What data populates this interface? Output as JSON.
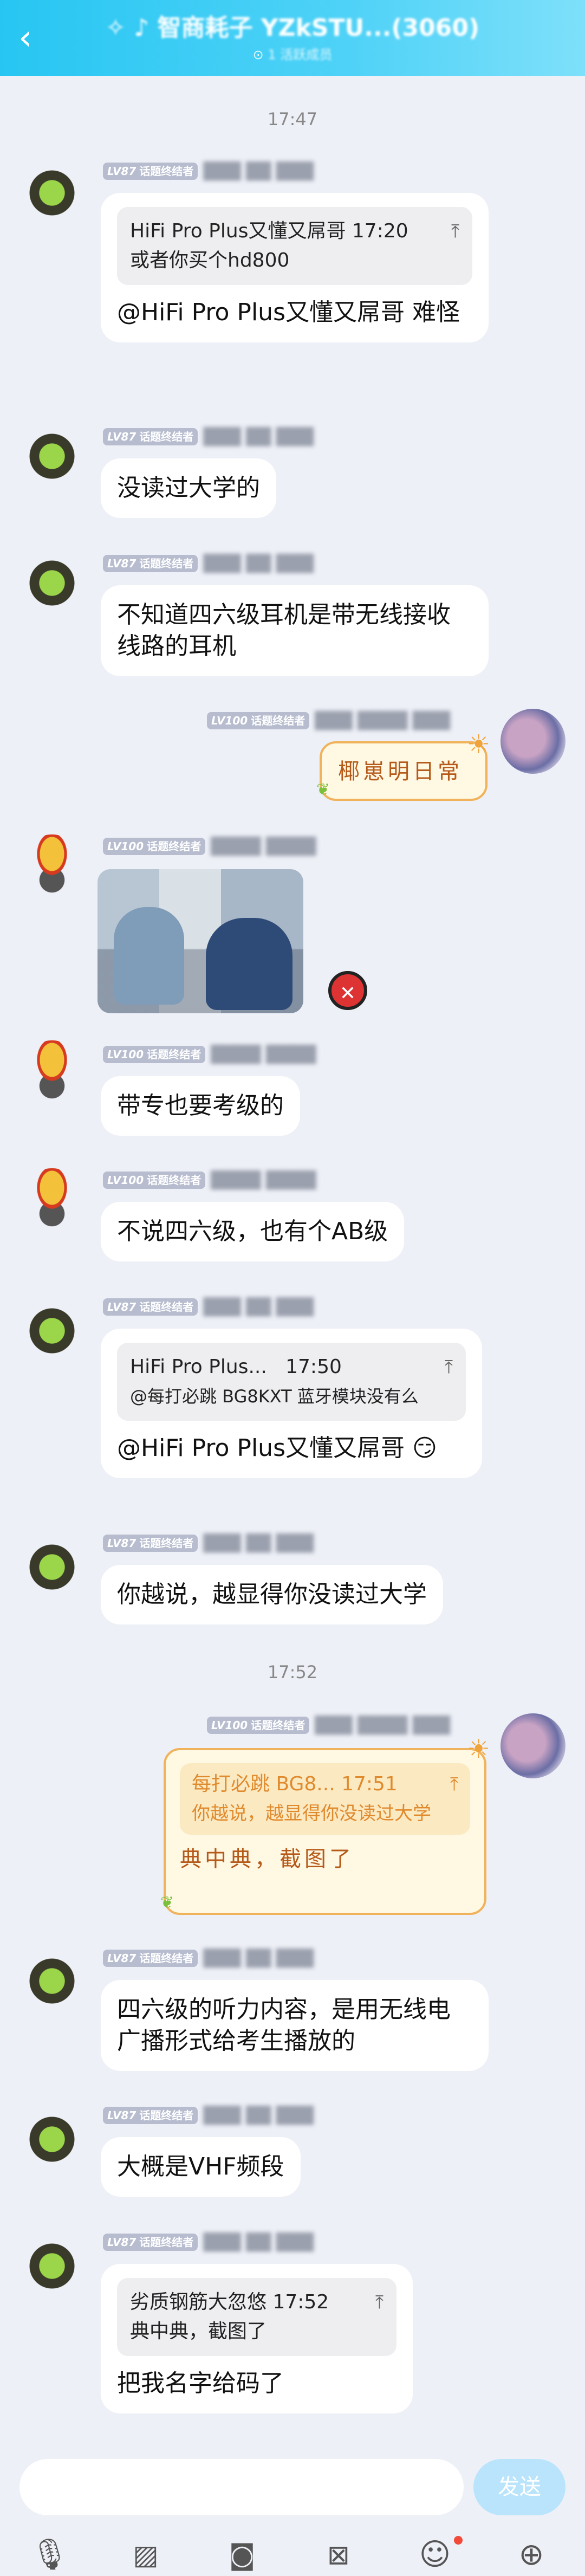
{
  "header": {
    "back_icon": "chevron-left-icon",
    "title": "✧ ♪ 智商耗子 YZkSTU...(3060)",
    "subtitle_icon": "dot-icon",
    "subtitle": "1 活跃成员"
  },
  "times": [
    "17:47",
    "17:52"
  ],
  "badges": {
    "lv87": "LV87",
    "lv100": "LV100",
    "label": "话题终结者"
  },
  "names": {
    "green": "███ ██ ███",
    "straw": "████ ████",
    "self": "███ ████ ███"
  },
  "messages": [
    {
      "quote_author_time": "HiFi Pro Plus又懂又屌哥 17:20",
      "quote_text": "或者你买个hd800",
      "text": "@HiFi Pro Plus又懂又屌哥 难怪"
    },
    {
      "text": "没读过大学的"
    },
    {
      "text": "不知道四六级耳机是带无线接收线路的耳机"
    },
    {
      "text": "椰崽明日常"
    },
    {
      "image_alt": "photo"
    },
    {
      "text": "带专也要考级的"
    },
    {
      "text": "不说四六级，也有个AB级"
    },
    {
      "quote_author": "HiFi Pro Plus...",
      "quote_time": "17:50",
      "quote_text": "@每打必跳 BG8KXT 蓝牙模块没有么",
      "text": "@HiFi Pro Plus又懂又屌哥 😏"
    },
    {
      "text": "你越说，越显得你没读过大学"
    },
    {
      "quote_author": "每打必跳 BG8...",
      "quote_time": "17:51",
      "quote_text": "你越说，越显得你没读过大学",
      "text": "典中典，截图了"
    },
    {
      "text": "四六级的听力内容，是用无线电广播形式给考生播放的"
    },
    {
      "text": "大概是VHF频段"
    },
    {
      "quote_author_time": "劣质钢筋大忽悠 17:52",
      "quote_text": "典中典，截图了",
      "text": "把我名字给码了"
    }
  ],
  "input": {
    "placeholder": "",
    "send_label": "发送"
  },
  "toolbar": [
    "mic-icon",
    "image-icon",
    "camera-icon",
    "red-packet-icon",
    "emoji-icon",
    "plus-icon"
  ],
  "colors": {
    "header": "#27c6f2",
    "background": "#eef0f7",
    "bubble": "#ffffff",
    "deco_border": "#f0b25a",
    "send": "#b9e4fb"
  }
}
